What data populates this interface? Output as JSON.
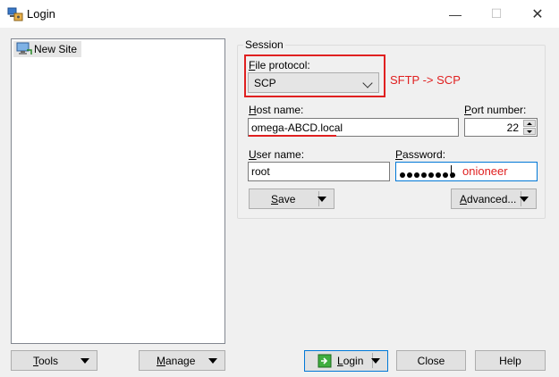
{
  "window": {
    "title": "Login",
    "controls": {
      "minimize": "—",
      "maximize": "☐",
      "close": "✕"
    }
  },
  "site_tree": {
    "items": [
      {
        "label": "New Site",
        "icon": "computer-icon"
      }
    ]
  },
  "session": {
    "group_label": "Session",
    "file_protocol": {
      "label_mnemonic": "F",
      "label_rest": "ile protocol:",
      "value": "SCP"
    },
    "host_name": {
      "label_mnemonic": "H",
      "label_rest": "ost name:",
      "value": "omega-ABCD.local"
    },
    "port_number": {
      "label_mnemonic": "P",
      "label_rest": "ort number:",
      "value": "22"
    },
    "user_name": {
      "label_mnemonic": "U",
      "label_rest": "ser name:",
      "value": "root"
    },
    "password": {
      "label_mnemonic": "P",
      "label_rest": "assword:",
      "masked_length": 8
    },
    "save_button": {
      "mnemonic": "S",
      "rest": "ave"
    },
    "advanced_button": {
      "mnemonic": "A",
      "rest": "dvanced..."
    }
  },
  "annotations": {
    "protocol_note": "SFTP -> SCP",
    "password_note": "onioneer",
    "color": "#e02020"
  },
  "bottom": {
    "tools": {
      "mnemonic": "T",
      "rest": "ools"
    },
    "manage": {
      "mnemonic": "M",
      "rest": "anage"
    },
    "login": {
      "mnemonic": "L",
      "rest": "ogin"
    },
    "close": "Close",
    "help": "Help"
  }
}
